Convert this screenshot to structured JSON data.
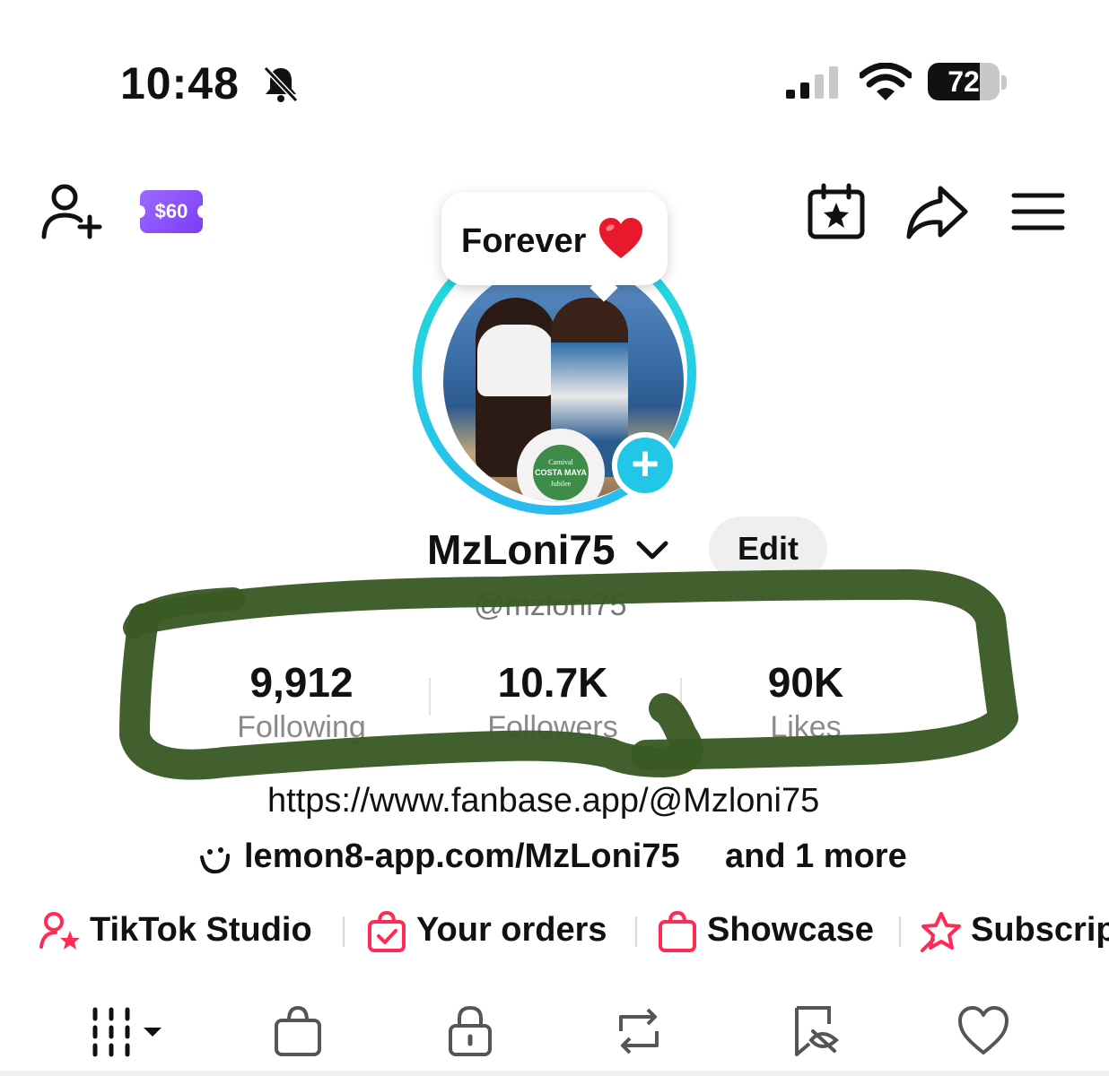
{
  "status_bar": {
    "time": "10:48",
    "battery": "72",
    "battery_level_pct": 72
  },
  "top_nav": {
    "coupon_label": "$60"
  },
  "profile": {
    "status_bubble": "Forever",
    "username": "MzLoni75",
    "handle": "@mzloni75",
    "edit_label": "Edit"
  },
  "avatar": {
    "badge_text_1": "Carnival",
    "badge_text_2": "COSTA MAYA",
    "badge_text_3": "Jubilee"
  },
  "stats": [
    {
      "value": "9,912",
      "label": "Following"
    },
    {
      "value": "10.7K",
      "label": "Followers"
    },
    {
      "value": "90K",
      "label": "Likes"
    }
  ],
  "bio": {
    "link": "https://www.fanbase.app/@Mzloni75",
    "lemon_link": "lemon8-app.com/MzLoni75",
    "more": "and 1 more"
  },
  "shortcuts": [
    {
      "label": "TikTok Studio",
      "icon": "person-star-icon"
    },
    {
      "label": "Your orders",
      "icon": "order-bag-icon"
    },
    {
      "label": "Showcase",
      "icon": "shopping-bag-icon"
    },
    {
      "label": "Subscrip",
      "icon": "subscription-star-icon"
    }
  ],
  "tabs": [
    "videos-grid-icon",
    "shop-bag-icon",
    "lock-icon",
    "repost-icon",
    "favorites-icon",
    "liked-heart-icon"
  ],
  "colors": {
    "accent_pink": "#fe2c55",
    "ring_cyan": "#22e3d6",
    "coupon_purple": "#8a4ef8",
    "scribble_green": "#3a5a24"
  }
}
